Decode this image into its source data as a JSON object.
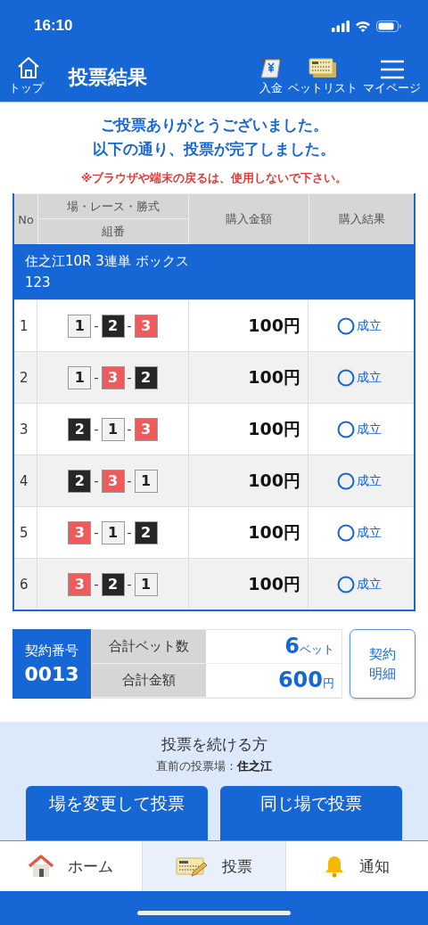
{
  "status_bar": {
    "time": "16:10"
  },
  "header": {
    "back": {
      "label": "トップ"
    },
    "title": "投票結果",
    "actions": [
      {
        "kind": "deposit",
        "label": "入金"
      },
      {
        "kind": "betlist",
        "label": "ベットリスト"
      },
      {
        "kind": "menu",
        "label": "マイページ"
      }
    ]
  },
  "messages": {
    "thanks": [
      "ご投票ありがとうございました。",
      "以下の通り、投票が完了しました。"
    ],
    "warning": "※ブラウザや端末の戻るは、使用しないで下さい。"
  },
  "table": {
    "columns": {
      "no": "No",
      "race": "場・レース・勝式",
      "combo": "組番",
      "amount": "購入金額",
      "result": "購入結果"
    },
    "group": {
      "title": "住之江10R 3連単 ボックス",
      "numbers": "123"
    },
    "rows": [
      {
        "no": "1",
        "combo": [
          {
            "n": "1",
            "color": "#f2f2f2"
          },
          {
            "n": "2",
            "color": "#262626"
          },
          {
            "n": "3",
            "color": "#ef5a5a"
          }
        ],
        "amount": "100",
        "unit": "円",
        "result": "成立",
        "kind": "success"
      },
      {
        "no": "2",
        "combo": [
          {
            "n": "1",
            "color": "#f2f2f2"
          },
          {
            "n": "3",
            "color": "#ef5a5a"
          },
          {
            "n": "2",
            "color": "#262626"
          }
        ],
        "amount": "100",
        "unit": "円",
        "result": "成立",
        "kind": "success"
      },
      {
        "no": "3",
        "combo": [
          {
            "n": "2",
            "color": "#262626"
          },
          {
            "n": "1",
            "color": "#f2f2f2"
          },
          {
            "n": "3",
            "color": "#ef5a5a"
          }
        ],
        "amount": "100",
        "unit": "円",
        "result": "成立",
        "kind": "success"
      },
      {
        "no": "4",
        "combo": [
          {
            "n": "2",
            "color": "#262626"
          },
          {
            "n": "3",
            "color": "#ef5a5a"
          },
          {
            "n": "1",
            "color": "#f2f2f2"
          }
        ],
        "amount": "100",
        "unit": "円",
        "result": "成立",
        "kind": "success"
      },
      {
        "no": "5",
        "combo": [
          {
            "n": "3",
            "color": "#ef5a5a"
          },
          {
            "n": "1",
            "color": "#f2f2f2"
          },
          {
            "n": "2",
            "color": "#262626"
          }
        ],
        "amount": "100",
        "unit": "円",
        "result": "成立",
        "kind": "success"
      },
      {
        "no": "6",
        "combo": [
          {
            "n": "3",
            "color": "#ef5a5a"
          },
          {
            "n": "2",
            "color": "#262626"
          },
          {
            "n": "1",
            "color": "#f2f2f2"
          }
        ],
        "amount": "100",
        "unit": "円",
        "result": "成立",
        "kind": "success"
      }
    ],
    "separator": "-"
  },
  "summary": {
    "contract_label": "契約番号",
    "contract_no": "0013",
    "bets_label": "合計ベット数",
    "bets": "6",
    "bets_unit": "ベット",
    "total_label": "合計金額",
    "total": "600",
    "total_unit": "円",
    "detail_button": "契約明細"
  },
  "continue": {
    "title": "投票を続ける方",
    "last_venue_label": "直前の投票場：",
    "last_venue": "住之江",
    "buttons": [
      "場を変更して投票",
      "同じ場で投票"
    ]
  },
  "bottom_nav": [
    {
      "kind": "home",
      "label": "ホーム",
      "selected": false
    },
    {
      "kind": "vote",
      "label": "投票",
      "selected": true
    },
    {
      "kind": "bell",
      "label": "通知",
      "selected": false
    }
  ]
}
